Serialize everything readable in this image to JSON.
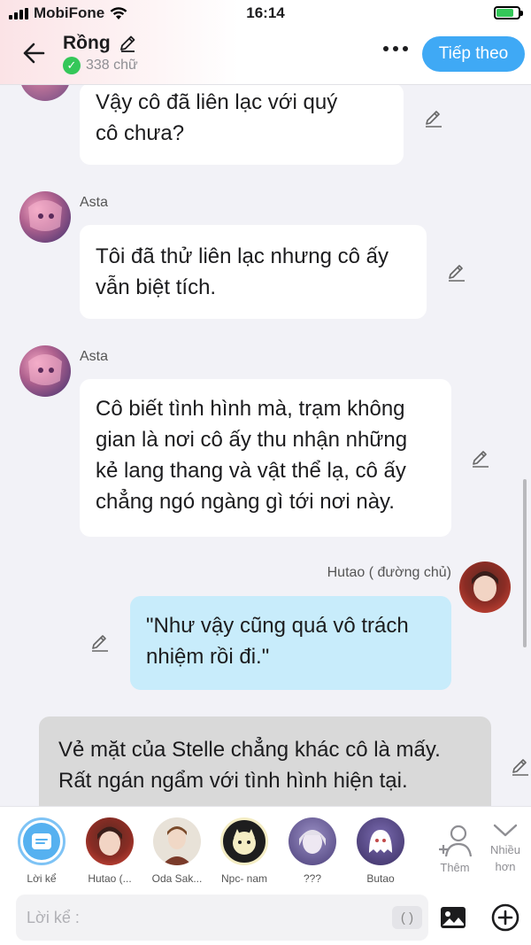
{
  "status": {
    "carrier": "MobiFone",
    "time": "16:14"
  },
  "header": {
    "title": "Rồng",
    "word_count": "338 chữ",
    "next_label": "Tiếp theo"
  },
  "messages": [
    {
      "speaker": "",
      "lines": [
        "Vậy cô đã liên lạc với quý",
        "cô chưa?"
      ]
    },
    {
      "speaker": "Asta",
      "lines": [
        "Tôi đã thử liên lạc nhưng cô ấy",
        "vẫn biệt tích."
      ]
    },
    {
      "speaker": "Asta",
      "lines": [
        "Cô biết tình hình mà, trạm không",
        "gian là nơi cô ấy thu nhận những",
        "kẻ lang thang và vật thể lạ, cô ấy",
        "chẳng ngó ngàng gì tới nơi này."
      ]
    },
    {
      "speaker": "Hutao ( đường chủ)",
      "lines": [
        "\"Như vậy cũng quá vô trách",
        "nhiệm rồi đi.\""
      ]
    },
    {
      "speaker": "",
      "lines": [
        "Vẻ mặt của Stelle chẳng khác cô là mấy.",
        "Rất ngán ngẩm với tình hình hiện tại."
      ]
    }
  ],
  "characters": [
    {
      "label": "Lời kể"
    },
    {
      "label": "Hutao (..."
    },
    {
      "label": "Oda Sak..."
    },
    {
      "label": "Npc- nam"
    },
    {
      "label": "???"
    },
    {
      "label": "Butao"
    }
  ],
  "actions": {
    "add_label": "Thêm",
    "more_label_1": "Nhiều",
    "more_label_2": "hơn"
  },
  "input": {
    "placeholder": "Lời kể :",
    "paren": "( )"
  },
  "colors": {
    "accent": "#3fa9f5",
    "user_bubble": "#c8ecfb",
    "narration_bubble": "#d9d9d9"
  }
}
